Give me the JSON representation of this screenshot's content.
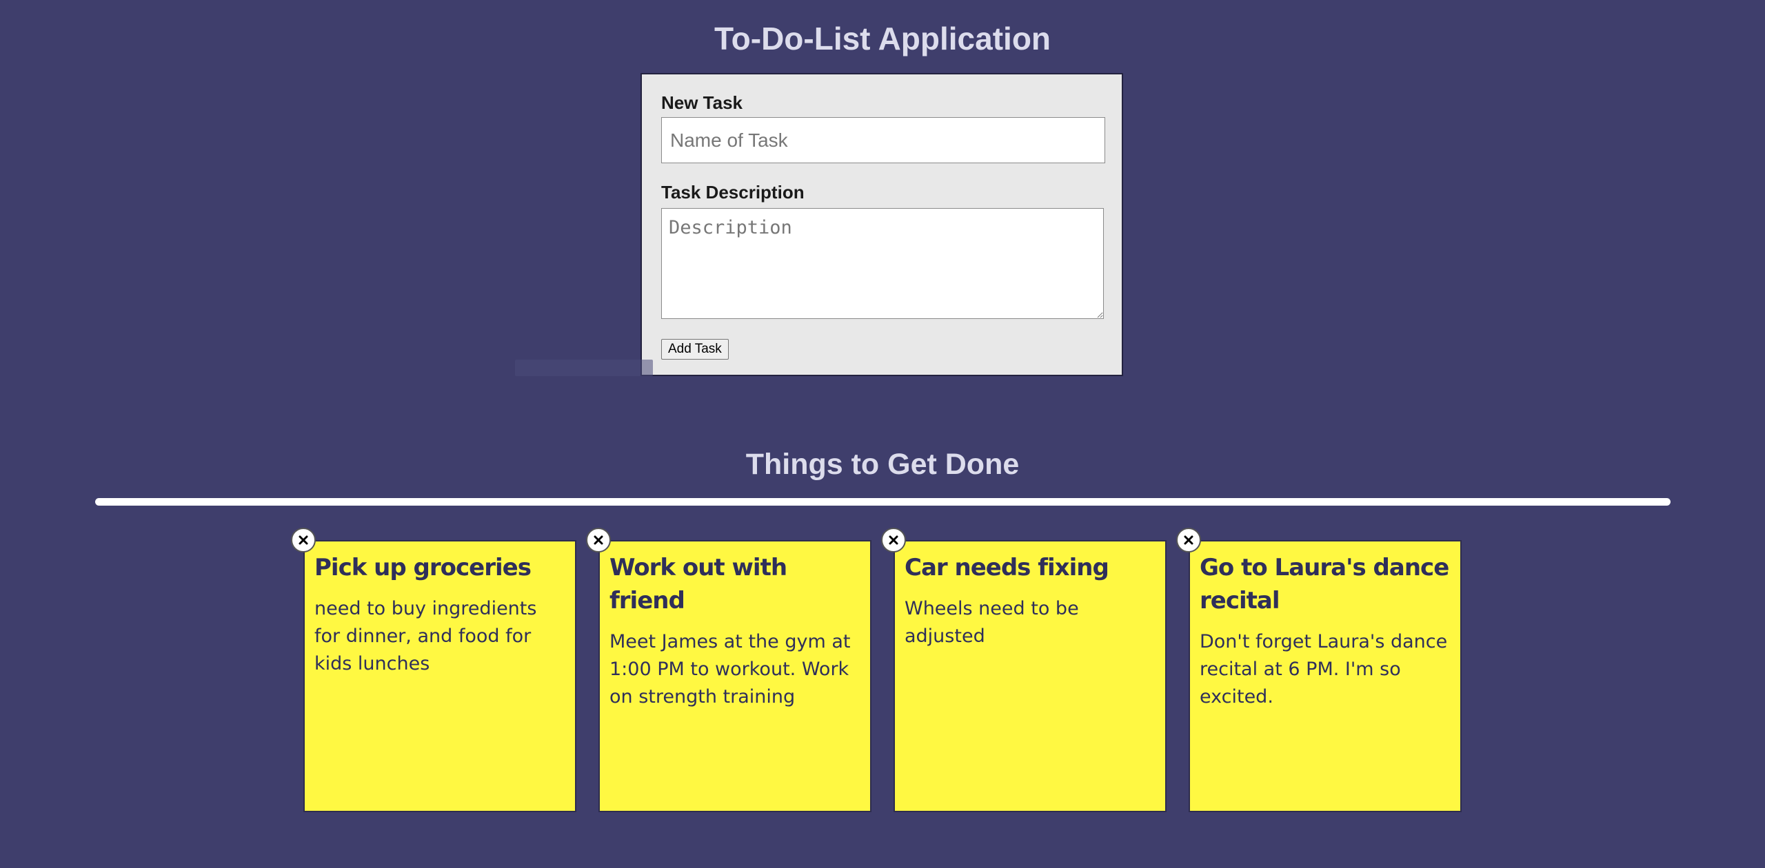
{
  "app_title": "To-Do-List Application",
  "form": {
    "task_label": "New Task",
    "task_placeholder": "Name of Task",
    "task_value": "",
    "desc_label": "Task Description",
    "desc_placeholder": "Description",
    "desc_value": "",
    "add_button": "Add Task"
  },
  "section_title": "Things to Get Done",
  "notes": [
    {
      "title": "Pick up groceries",
      "description": "need to buy ingredients for dinner, and food for kids lunches",
      "close_icon": "close-icon"
    },
    {
      "title": "Work out with friend",
      "description": "Meet James at the gym at 1:00 PM to workout. Work on strength training",
      "close_icon": "close-icon"
    },
    {
      "title": "Car needs fixing",
      "description": "Wheels need to be adjusted",
      "close_icon": "close-icon"
    },
    {
      "title": "Go to Laura's dance recital",
      "description": "Don't forget Laura's dance recital at 6 PM. I'm so excited.",
      "close_icon": "close-icon"
    }
  ],
  "colors": {
    "background": "#3f3e6c",
    "note": "#fff842",
    "note_text": "#2f2f5a",
    "heading": "#dcdcec",
    "form_bg": "#e8e8e8"
  }
}
